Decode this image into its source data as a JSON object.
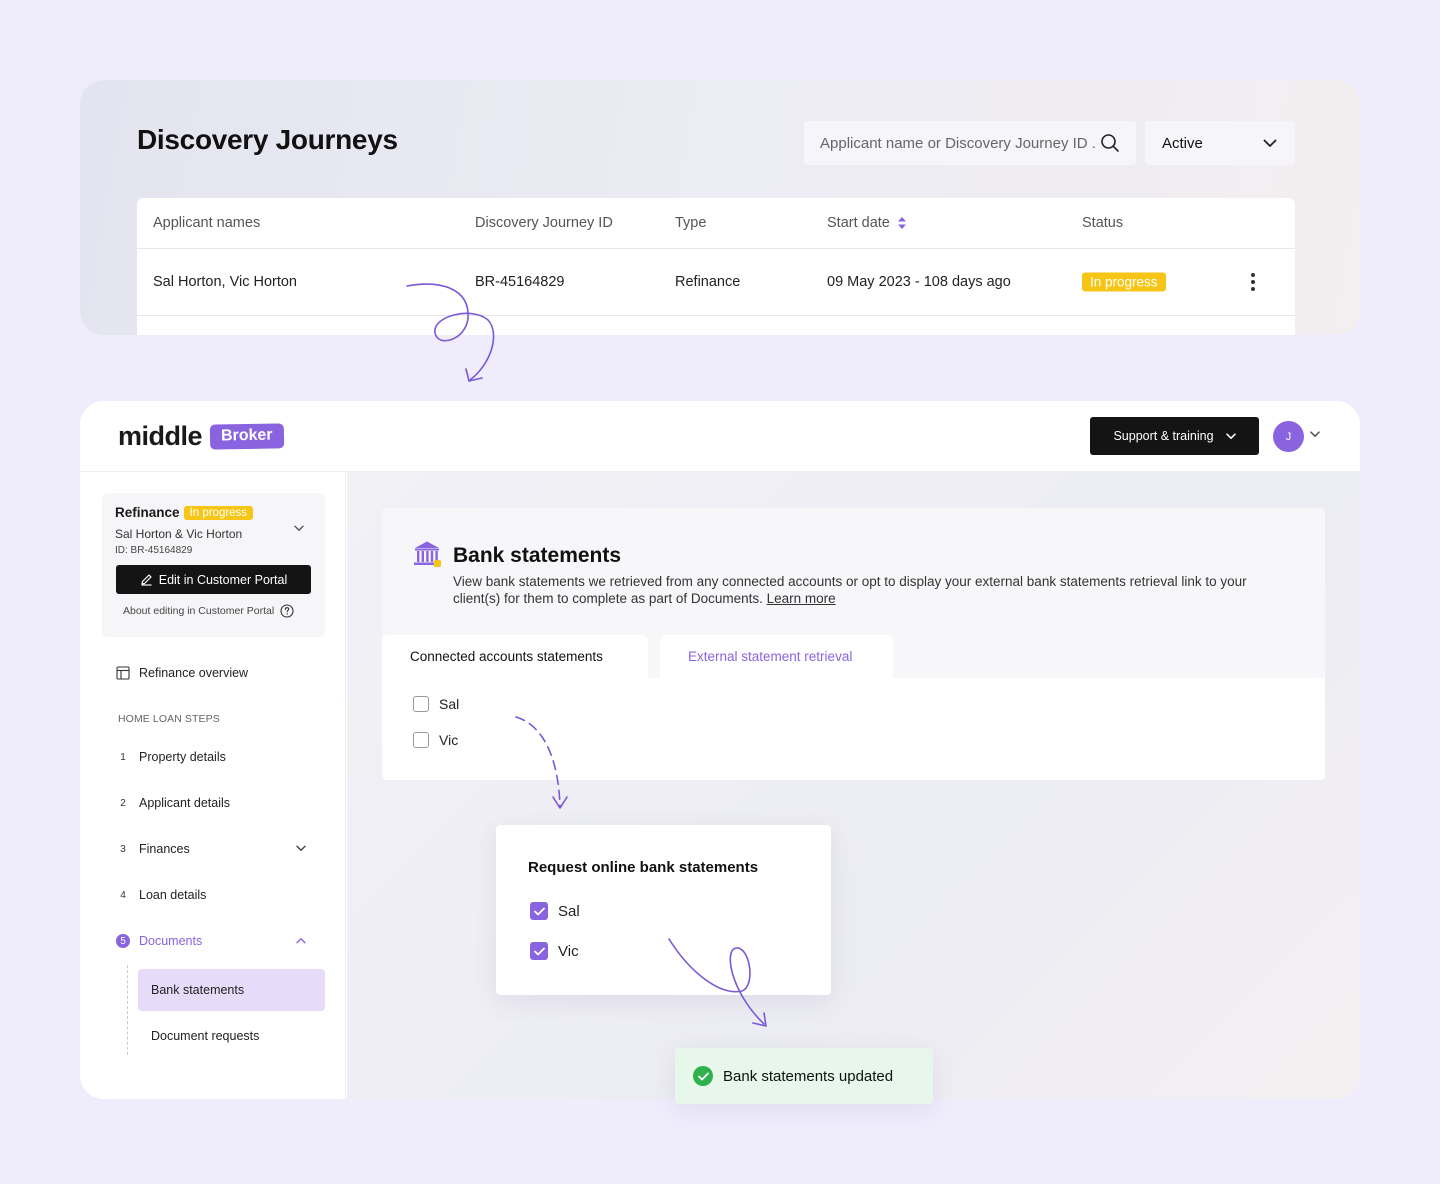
{
  "discovery": {
    "title": "Discovery Journeys",
    "search_placeholder": "Applicant name or Discovery Journey ID ...",
    "status_filter": "Active",
    "columns": [
      "Applicant names",
      "Discovery Journey ID",
      "Type",
      "Start date",
      "Status"
    ],
    "rows": [
      {
        "applicants": "Sal Horton, Vic Horton",
        "journey_id": "BR-45164829",
        "type": "Refinance",
        "start_date": "09 May 2023 - 108 days ago",
        "status": "In progress"
      }
    ]
  },
  "app": {
    "logo": "middle",
    "logo_badge": "Broker",
    "support_label": "Support & training",
    "avatar_initial": "J",
    "accent_color": "#8a63e0",
    "status_color": "#f6c515"
  },
  "journey": {
    "type": "Refinance",
    "status": "In progress",
    "names": "Sal Horton & Vic Horton",
    "id": "ID: BR-45164829",
    "edit_label": "Edit in Customer Portal",
    "about_label": "About editing in Customer Portal"
  },
  "sidebar": {
    "overview_label": "Refinance overview",
    "section_label": "HOME LOAN STEPS",
    "steps": [
      {
        "num": "1",
        "label": "Property details"
      },
      {
        "num": "2",
        "label": "Applicant details"
      },
      {
        "num": "3",
        "label": "Finances"
      },
      {
        "num": "4",
        "label": "Loan details"
      },
      {
        "num": "5",
        "label": "Documents"
      }
    ],
    "sub_items": [
      "Bank statements",
      "Document requests"
    ]
  },
  "bank": {
    "title": "Bank statements",
    "description": "View bank statements we retrieved from any connected accounts or opt to display your external bank statements retrieval link to your client(s) for them to complete as part of Documents.",
    "learn_more": "Learn more",
    "tabs": [
      "Connected accounts statements",
      "External statement retrieval"
    ],
    "applicants": [
      {
        "name": "Sal",
        "checked": false
      },
      {
        "name": "Vic",
        "checked": false
      }
    ]
  },
  "request": {
    "title": "Request online bank statements",
    "applicants": [
      {
        "name": "Sal",
        "checked": true
      },
      {
        "name": "Vic",
        "checked": true
      }
    ]
  },
  "toast": {
    "message": "Bank statements updated"
  }
}
